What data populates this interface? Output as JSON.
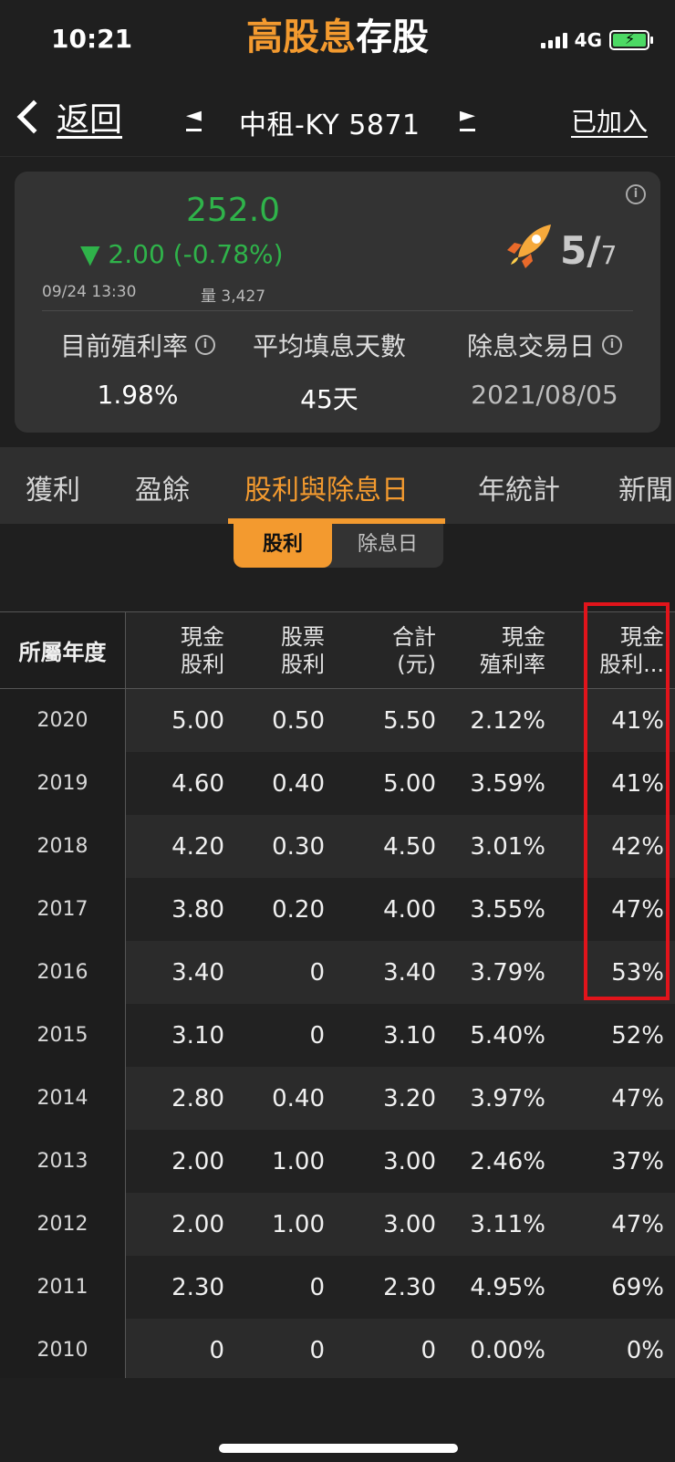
{
  "status_bar": {
    "time": "10:21",
    "network": "4G"
  },
  "app_title": {
    "highlight": "高股息",
    "rest": "存股"
  },
  "nav": {
    "back_label": "返回",
    "prev_label": "◄",
    "stock_name": "中租-KY 5871",
    "next_label": "►",
    "added_label": "已加入"
  },
  "quote": {
    "price": "252.0",
    "change": "▼ 2.00 (-0.78%)",
    "datetime": "09/24 13:30",
    "volume": "量 3,427",
    "rank_num": "5/",
    "rank_den": "7",
    "info_glyph": "i",
    "color_down": "#2fb34a"
  },
  "metrics": [
    {
      "label": "目前殖利率",
      "value": "1.98%",
      "has_info": true
    },
    {
      "label": "平均填息天數",
      "value": "45天",
      "has_info": false
    },
    {
      "label": "除息交易日",
      "value": "2021/08/05",
      "has_info": true
    }
  ],
  "tabs": [
    {
      "label": "獲利",
      "active": false
    },
    {
      "label": "盈餘",
      "active": false
    },
    {
      "label": "股利與除息日",
      "active": true
    },
    {
      "label": "年統計",
      "active": false
    },
    {
      "label": "新聞",
      "active": false
    }
  ],
  "segments": {
    "active": "股利",
    "inactive": "除息日"
  },
  "table": {
    "headers": {
      "year": "所屬年度",
      "cash_l1": "現金",
      "cash_l2": "股利",
      "stock_l1": "股票",
      "stock_l2": "股利",
      "total_l1": "合計",
      "total_l2": "(元)",
      "yield_l1": "現金",
      "yield_l2": "殖利率",
      "payout_l1": "現金",
      "payout_l2": "股利..."
    },
    "rows": [
      {
        "year": "2020",
        "cash": "5.00",
        "stock": "0.50",
        "total": "5.50",
        "yield": "2.12%",
        "payout": "41%"
      },
      {
        "year": "2019",
        "cash": "4.60",
        "stock": "0.40",
        "total": "5.00",
        "yield": "3.59%",
        "payout": "41%"
      },
      {
        "year": "2018",
        "cash": "4.20",
        "stock": "0.30",
        "total": "4.50",
        "yield": "3.01%",
        "payout": "42%"
      },
      {
        "year": "2017",
        "cash": "3.80",
        "stock": "0.20",
        "total": "4.00",
        "yield": "3.55%",
        "payout": "47%"
      },
      {
        "year": "2016",
        "cash": "3.40",
        "stock": "0",
        "total": "3.40",
        "yield": "3.79%",
        "payout": "53%"
      },
      {
        "year": "2015",
        "cash": "3.10",
        "stock": "0",
        "total": "3.10",
        "yield": "5.40%",
        "payout": "52%"
      },
      {
        "year": "2014",
        "cash": "2.80",
        "stock": "0.40",
        "total": "3.20",
        "yield": "3.97%",
        "payout": "47%"
      },
      {
        "year": "2013",
        "cash": "2.00",
        "stock": "1.00",
        "total": "3.00",
        "yield": "2.46%",
        "payout": "37%"
      },
      {
        "year": "2012",
        "cash": "2.00",
        "stock": "1.00",
        "total": "3.00",
        "yield": "3.11%",
        "payout": "47%"
      },
      {
        "year": "2011",
        "cash": "2.30",
        "stock": "0",
        "total": "2.30",
        "yield": "4.95%",
        "payout": "69%"
      },
      {
        "year": "2010",
        "cash": "0",
        "stock": "0",
        "total": "0",
        "yield": "0.00%",
        "payout": "0%"
      }
    ]
  },
  "colors": {
    "accent": "#f39a2f",
    "highlight_border": "#e1141b"
  }
}
